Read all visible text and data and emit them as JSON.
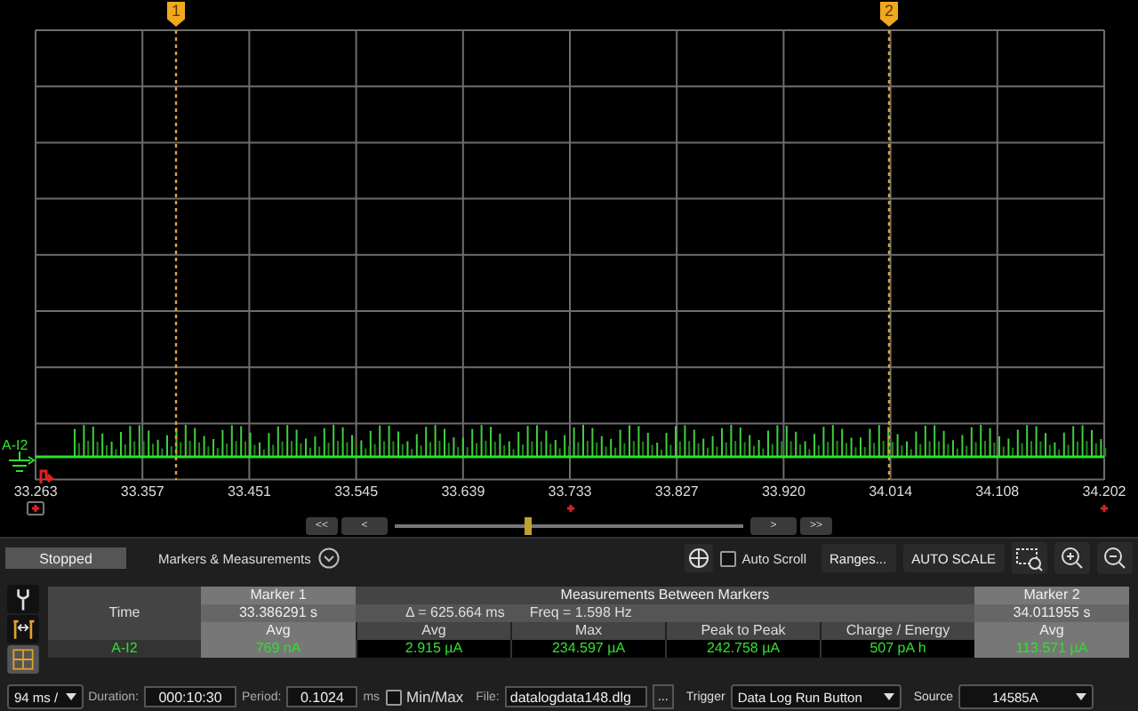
{
  "plot": {
    "channel_label": "A-I2",
    "markers": [
      {
        "label": "1"
      },
      {
        "label": "2"
      }
    ],
    "x_ticks": [
      "33.263",
      "33.357",
      "33.451",
      "33.545",
      "33.639",
      "33.733",
      "33.827",
      "33.920",
      "34.014",
      "34.108",
      "34.202"
    ]
  },
  "scroll_buttons": [
    "<<",
    "<",
    ">",
    ">>"
  ],
  "toolbar": {
    "status": "Stopped",
    "section": "Markers & Measurements",
    "auto_scroll": {
      "label": "Auto Scroll",
      "checked": false
    },
    "buttons": [
      "Ranges...",
      "AUTO SCALE"
    ]
  },
  "table": {
    "marker1": "Marker 1",
    "between": "Measurements Between Markers",
    "marker2": "Marker 2",
    "time_label": "Time",
    "marker1_time": "33.386291 s",
    "delta": "Δ = 625.664 ms",
    "freq": "Freq = 1.598 Hz",
    "marker2_time": "34.011955 s",
    "columns": [
      "Avg",
      "Avg",
      "Max",
      "Peak to Peak",
      "Charge / Energy",
      "Avg"
    ],
    "rows": [
      {
        "channel": "A-I2",
        "values": [
          "769 nA",
          "2.915 µA",
          "234.597 µA",
          "242.758 µA",
          "507 pA h",
          "113.571 µA"
        ]
      }
    ]
  },
  "bottom": {
    "rate": "94 ms /",
    "duration_label": "Duration:",
    "duration": "000:10:30",
    "period_label": "Period:",
    "period": "0.1024",
    "period_unit": "ms",
    "minmax": {
      "label": "Min/Max",
      "checked": false
    },
    "file_label": "File:",
    "file": "datalogdata148.dlg",
    "browse": "...",
    "trigger_label": "Trigger",
    "trigger": "Data Log Run Button",
    "source_label": "Source",
    "source": "14585A"
  }
}
